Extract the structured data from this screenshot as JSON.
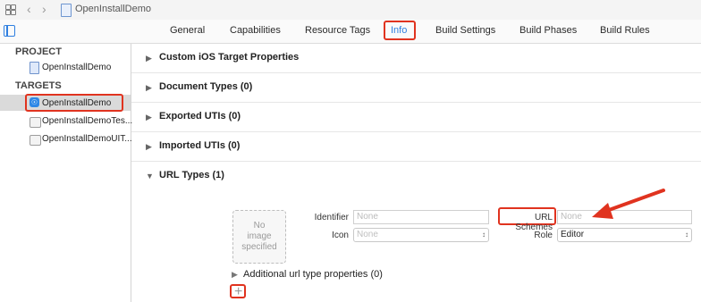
{
  "window": {
    "title": "OpenInstallDemo"
  },
  "tabs": [
    {
      "label": "General"
    },
    {
      "label": "Capabilities"
    },
    {
      "label": "Resource Tags"
    },
    {
      "label": "Info"
    },
    {
      "label": "Build Settings"
    },
    {
      "label": "Build Phases"
    },
    {
      "label": "Build Rules"
    }
  ],
  "sidebar": {
    "project_header": "PROJECT",
    "project_item": "OpenInstallDemo",
    "targets_header": "TARGETS",
    "targets": [
      {
        "label": "OpenInstallDemo",
        "icon": "app-icon"
      },
      {
        "label": "OpenInstallDemoTes...",
        "icon": "folder-icon"
      },
      {
        "label": "OpenInstallDemoUIT...",
        "icon": "folder-icon"
      }
    ]
  },
  "sections": [
    {
      "label": "Custom iOS Target Properties"
    },
    {
      "label": "Document Types (0)"
    },
    {
      "label": "Exported UTIs (0)"
    },
    {
      "label": "Imported UTIs (0)"
    },
    {
      "label": "URL Types (1)"
    }
  ],
  "url_type": {
    "image_placeholder": "No image specified",
    "identifier_label": "Identifier",
    "identifier_placeholder": "None",
    "icon_label": "Icon",
    "icon_value": "None",
    "url_schemes_label": "URL Schemes",
    "url_schemes_placeholder": "None",
    "role_label": "Role",
    "role_value": "Editor",
    "additional": "Additional url type properties (0)",
    "add_symbol": "+"
  },
  "colors": {
    "accent": "#2f7fe0",
    "annotation": "#e0331f",
    "selection": "#dadada"
  }
}
